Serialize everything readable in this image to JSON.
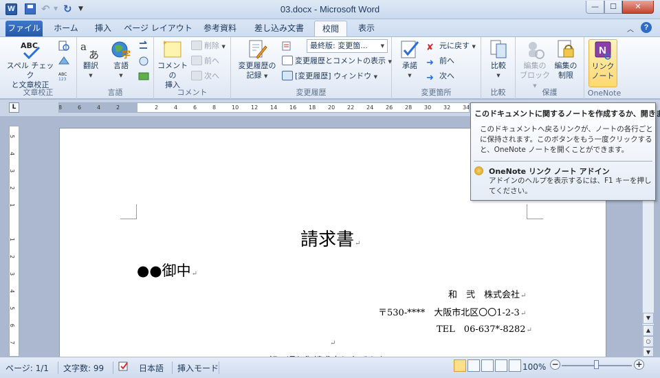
{
  "window": {
    "title": "03.docx - Microsoft Word",
    "app_icon_letter": "W",
    "min": "—",
    "max": "☐",
    "close": "✕"
  },
  "tabs": [
    {
      "label": "ファイル"
    },
    {
      "label": "ホーム"
    },
    {
      "label": "挿入"
    },
    {
      "label": "ページ レイアウト"
    },
    {
      "label": "参考資料"
    },
    {
      "label": "差し込み文書"
    },
    {
      "label": "校閲",
      "active": true
    },
    {
      "label": "表示"
    }
  ],
  "ribbon": {
    "groups": {
      "proofing": {
        "label": "文章校正",
        "spelling": "スペル チェック\nと文章校正",
        "spelling_line1": "スペル チェック",
        "spelling_line2": "と文章校正"
      },
      "language": {
        "label": "言語",
        "translate": "翻訳",
        "language": "言語"
      },
      "comments": {
        "label": "コメント",
        "insert_comment_line1": "コメントの",
        "insert_comment_line2": "挿入",
        "delete": "削除",
        "prev": "前へ",
        "next": "次へ"
      },
      "tracking": {
        "label": "変更履歴",
        "track_changes_line1": "変更履歴の",
        "track_changes_line2": "記録",
        "display_select": "最終版: 変更箇...",
        "show_markup": "変更履歴とコメントの表示",
        "reviewing_pane": "[変更履歴] ウィンドウ"
      },
      "changes": {
        "label": "変更箇所",
        "accept": "承諾",
        "reject": "元に戻す",
        "prev": "前へ",
        "next": "次へ"
      },
      "compare": {
        "label": "比較",
        "compare": "比較"
      },
      "protect": {
        "label": "保護",
        "block_authors_line1": "編集の",
        "block_authors_line2": "ブロック",
        "restrict_line1": "編集の",
        "restrict_line2": "制限"
      },
      "onenote": {
        "label": "OneNote",
        "linked_notes_line1": "リンク",
        "linked_notes_line2": "ノート"
      }
    }
  },
  "ruler": {
    "corner": "L",
    "numbers": [
      "8",
      "6",
      "4",
      "2",
      "",
      "2",
      "4",
      "6",
      "8",
      "10",
      "12",
      "14",
      "16",
      "18",
      "20",
      "22",
      "24",
      "26",
      "28",
      "30",
      "32",
      "34"
    ],
    "vnumbers": [
      "5",
      "4",
      "3",
      "2",
      "1",
      "",
      "1",
      "2",
      "3",
      "4",
      "5",
      "6",
      "7"
    ]
  },
  "document": {
    "title": "請求書",
    "addressee": "●●御中",
    "company": "和　弐　株式会社",
    "postal": "〒530-****　大阪市北区〇〇1-2-3",
    "tel": "TEL　06-637*-8282",
    "cut_line": "下記の通り御請求申し上げます",
    "para_mark": "↵"
  },
  "tooltip": {
    "title": "このドキュメントに関するノートを作成するか、開きます",
    "body": "このドキュメントへ戻るリンクが、ノートの各行ごとに保持されます。このボタンをもう一度クリックすると、OneNote ノートを開くことができます。",
    "addin_title": "OneNote リンク ノート アドイン",
    "addin_body": "アドインのヘルプを表示するには、F1 キーを押してください。"
  },
  "statusbar": {
    "page": "ページ: 1/1",
    "words": "文字数: 99",
    "language": "日本語",
    "mode": "挿入モード",
    "zoom": "100%",
    "zoom_level": 1.0
  }
}
